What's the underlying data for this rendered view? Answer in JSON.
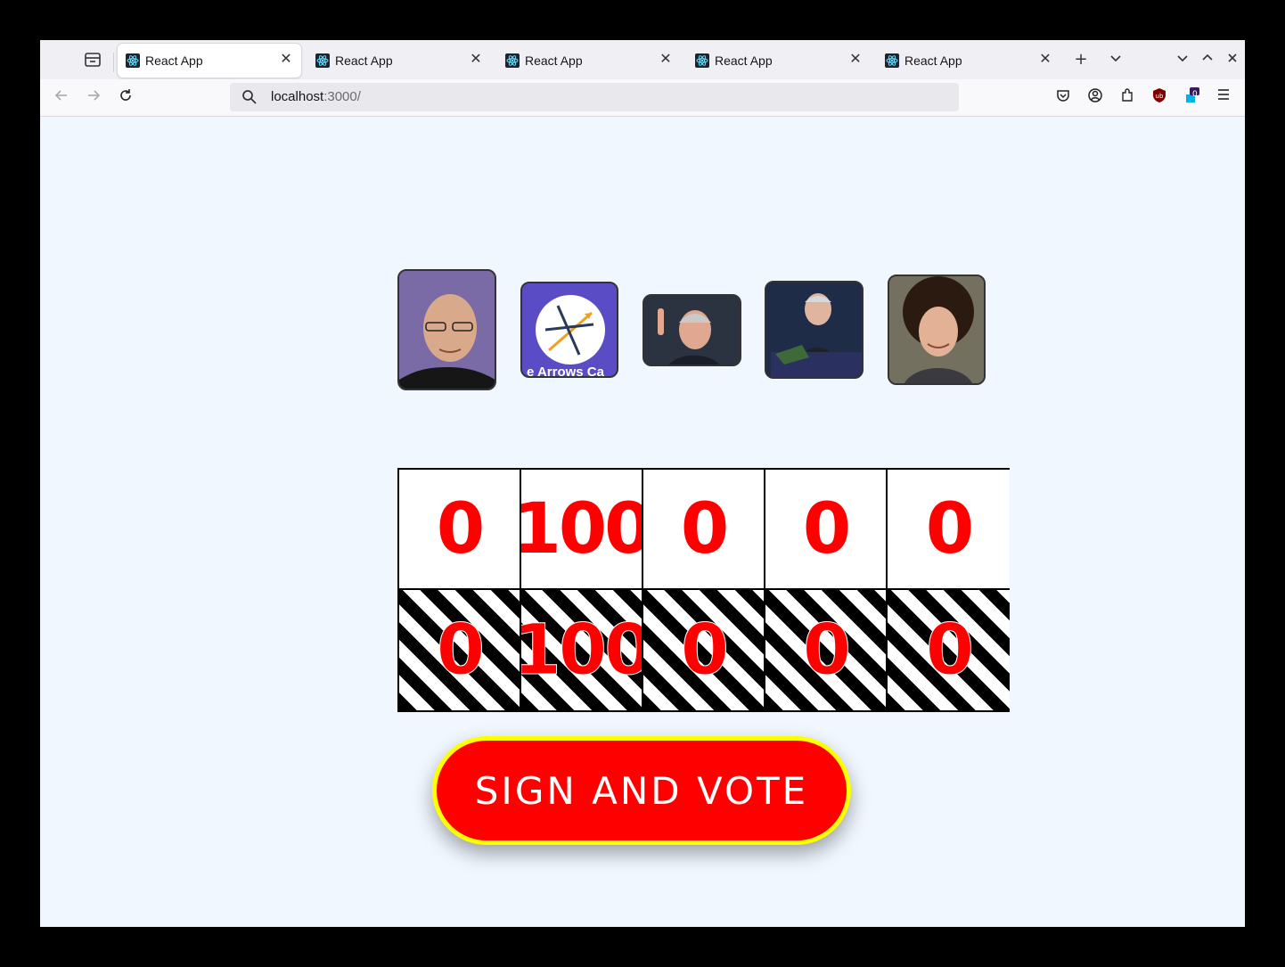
{
  "browser": {
    "tabs": [
      {
        "title": "React App",
        "active": true
      },
      {
        "title": "React App",
        "active": false
      },
      {
        "title": "React App",
        "active": false
      },
      {
        "title": "React App",
        "active": false
      },
      {
        "title": "React App",
        "active": false
      }
    ],
    "url_host": "localhost",
    "url_rest": ":3000/",
    "extension_badge": "0"
  },
  "candidates": [
    {
      "photo": "bald man with glasses photo",
      "votes_top": "0",
      "votes_bottom": "0"
    },
    {
      "photo": "Three Arrows Capital logo",
      "logo_text": "e Arrows Ca",
      "votes_top": "100",
      "votes_bottom": "100"
    },
    {
      "photo": "man pointing finger photo",
      "votes_top": "0",
      "votes_bottom": "0"
    },
    {
      "photo": "man at podium photo",
      "votes_top": "0",
      "votes_bottom": "0"
    },
    {
      "photo": "curly-haired man photo",
      "votes_top": "0",
      "votes_bottom": "0"
    }
  ],
  "vote_button_label": "SIGN AND VOTE",
  "colors": {
    "accent": "#ff0000",
    "button_border": "#ffff00",
    "page_bg": "#f0f7ff"
  }
}
